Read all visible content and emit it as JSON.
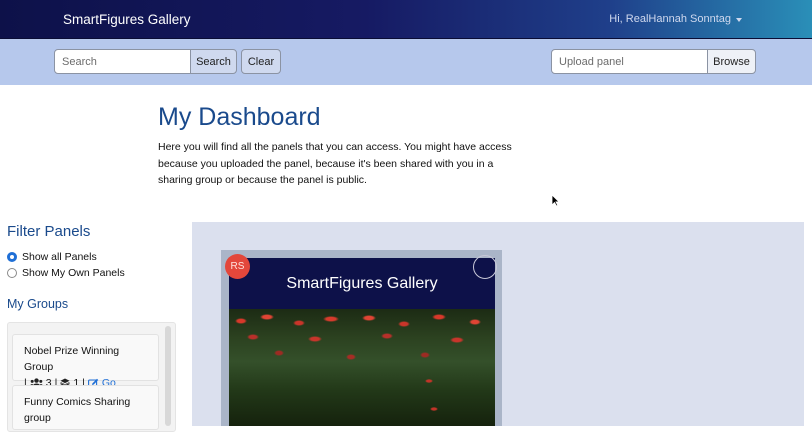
{
  "navbar": {
    "brand": "SmartFigures Gallery",
    "user_greeting": "Hi, RealHannah Sonntag",
    "dropdown_icon": "caret-down-icon"
  },
  "toolbar": {
    "search_placeholder": "Search",
    "search_label": "Search",
    "clear_label": "Clear",
    "upload_placeholder": "Upload panel",
    "browse_label": "Browse"
  },
  "header": {
    "title": "My Dashboard",
    "intro": "Here you will find all the panels that you can access. You might have access because you uploaded the panel, because it's been shared with you in a sharing group or because the panel is public."
  },
  "sidebar": {
    "filter_title": "Filter Panels",
    "filters": [
      {
        "label": "Show all Panels",
        "checked": true
      },
      {
        "label": "Show My Own Panels",
        "checked": false
      }
    ],
    "groups_title": "My Groups",
    "groups": [
      {
        "name": "Nobel Prize Winning Group",
        "members": "3",
        "panels": "1",
        "link_label": "Go"
      },
      {
        "name": "Funny Comics Sharing group"
      }
    ]
  },
  "panels": [
    {
      "title": "SmartFigures Gallery",
      "owner_initials": "RS"
    }
  ],
  "colors": {
    "accent": "#1a4a8c",
    "navbar_dark": "#0d1149",
    "toolbar_bg": "#b6c8ec",
    "main_bg": "#dbe0ee",
    "link": "#1f6fd6",
    "avatar": "#e3473b"
  }
}
